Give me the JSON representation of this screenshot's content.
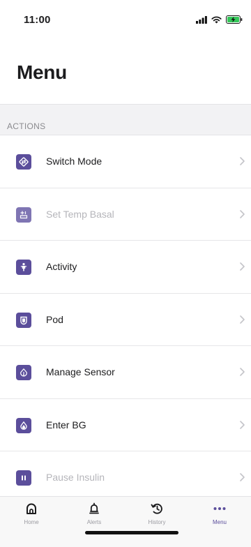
{
  "status_bar": {
    "time": "11:00"
  },
  "page": {
    "title": "Menu"
  },
  "section": {
    "label": "ACTIONS"
  },
  "menu": {
    "items": [
      {
        "label": "Switch Mode",
        "icon": "switch-mode-icon",
        "disabled": false
      },
      {
        "label": "Set Temp Basal",
        "icon": "temp-basal-icon",
        "disabled": true
      },
      {
        "label": "Activity",
        "icon": "activity-icon",
        "disabled": false
      },
      {
        "label": "Pod",
        "icon": "pod-icon",
        "disabled": false
      },
      {
        "label": "Manage Sensor",
        "icon": "sensor-icon",
        "disabled": false
      },
      {
        "label": "Enter BG",
        "icon": "blood-drop-icon",
        "disabled": false
      },
      {
        "label": "Pause Insulin",
        "icon": "pause-icon",
        "disabled": true
      }
    ]
  },
  "tab_bar": {
    "tabs": [
      {
        "label": "Home",
        "icon": "home-icon",
        "active": false
      },
      {
        "label": "Alerts",
        "icon": "bell-icon",
        "active": false
      },
      {
        "label": "History",
        "icon": "history-icon",
        "active": false
      },
      {
        "label": "Menu",
        "icon": "more-dots-icon",
        "active": true
      }
    ]
  },
  "colors": {
    "accent": "#5b4e9b",
    "disabled_text": "#b5b5ba",
    "section_bg": "#f2f2f4"
  }
}
